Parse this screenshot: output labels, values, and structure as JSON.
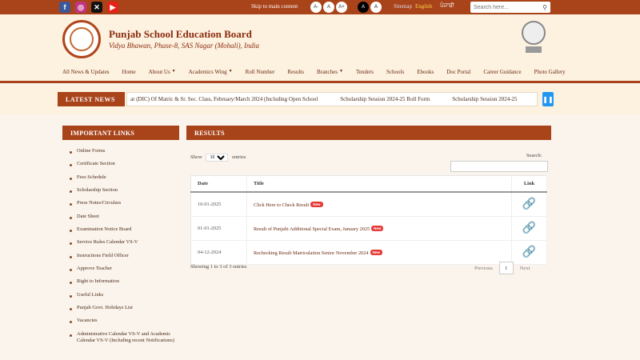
{
  "topbar": {
    "social": [
      {
        "icon": "facebook-icon",
        "glyph": "f"
      },
      {
        "icon": "instagram-icon",
        "glyph": "◎"
      },
      {
        "icon": "twitter-x-icon",
        "glyph": "✕"
      },
      {
        "icon": "youtube-icon",
        "glyph": "▶"
      }
    ],
    "skip_label": "Skip to main content",
    "font_sizes": [
      "A-",
      "A",
      "A+"
    ],
    "contrast": [
      "A",
      "A"
    ],
    "sitemap_label": "Sitemap",
    "lang_en": "English",
    "lang_pa": "ਪੰਜਾਬੀ",
    "search_placeholder": "Search here..."
  },
  "header": {
    "title": "Punjab School Education Board",
    "address": "Vidya Bhawan, Phase-8, SAS Nagar (Mohali), India"
  },
  "nav": [
    {
      "label": "All News & Updates",
      "caret": false
    },
    {
      "label": "Home",
      "caret": false
    },
    {
      "label": "About Us",
      "caret": true
    },
    {
      "label": "Academics Wing",
      "caret": true
    },
    {
      "label": "Roll Number",
      "caret": false
    },
    {
      "label": "Results",
      "caret": false
    },
    {
      "label": "Branches",
      "caret": true
    },
    {
      "label": "Tenders",
      "caret": false
    },
    {
      "label": "Schools",
      "caret": false
    },
    {
      "label": "Ebooks",
      "caret": false
    },
    {
      "label": "Doc Portal",
      "caret": false
    },
    {
      "label": "Career Guidance",
      "caret": false
    },
    {
      "label": "Photo Gallery",
      "caret": false
    }
  ],
  "ticker": {
    "label": "LATEST NEWS",
    "items": [
      "ar (DIC) Of Matric & Sr. Sec. Class, February/March 2024 (Including Open School",
      "Scholarship Session 2024-25 Roll Form",
      "Scholarship Session 2024-25"
    ]
  },
  "sidebar": {
    "heading": "IMPORTANT LINKS",
    "items": [
      "Online Forms",
      "Certificate Section",
      "Fees Schedule",
      "Scholarship Section",
      "Press Notes/Circulars",
      "Date Sheet",
      "Examination Notice Board",
      "Service Rules Calendar VS-V",
      "Instructions Field Officer",
      "Approve Teacher",
      "Right to Information",
      "Useful Links",
      "Punjab Govt. Holidays List",
      "Vacancies",
      "Administrative Calendar VS-V and Academic Calendar VS-V (Including recent Notifications)"
    ]
  },
  "results": {
    "heading": "RESULTS",
    "show_label": "Show",
    "show_value": "10",
    "entries_label": "entries",
    "search_label": "Search:",
    "columns": [
      "Date",
      "Title",
      "Link"
    ],
    "rows": [
      {
        "date": "10-01-2025",
        "title": "Click Here to Check Result",
        "badge": "New"
      },
      {
        "date": "01-01-2025",
        "title": "Result of Punjabi Additional Special Exam, January 2025",
        "badge": "New"
      },
      {
        "date": "04-12-2024",
        "title": "Rechecking Result Matriculation Senior November 2024",
        "badge": "New"
      }
    ],
    "showing_text": "Showing 1 to 3 of 3 entries",
    "prev_label": "Previous",
    "page": "1",
    "next_label": "Next"
  }
}
